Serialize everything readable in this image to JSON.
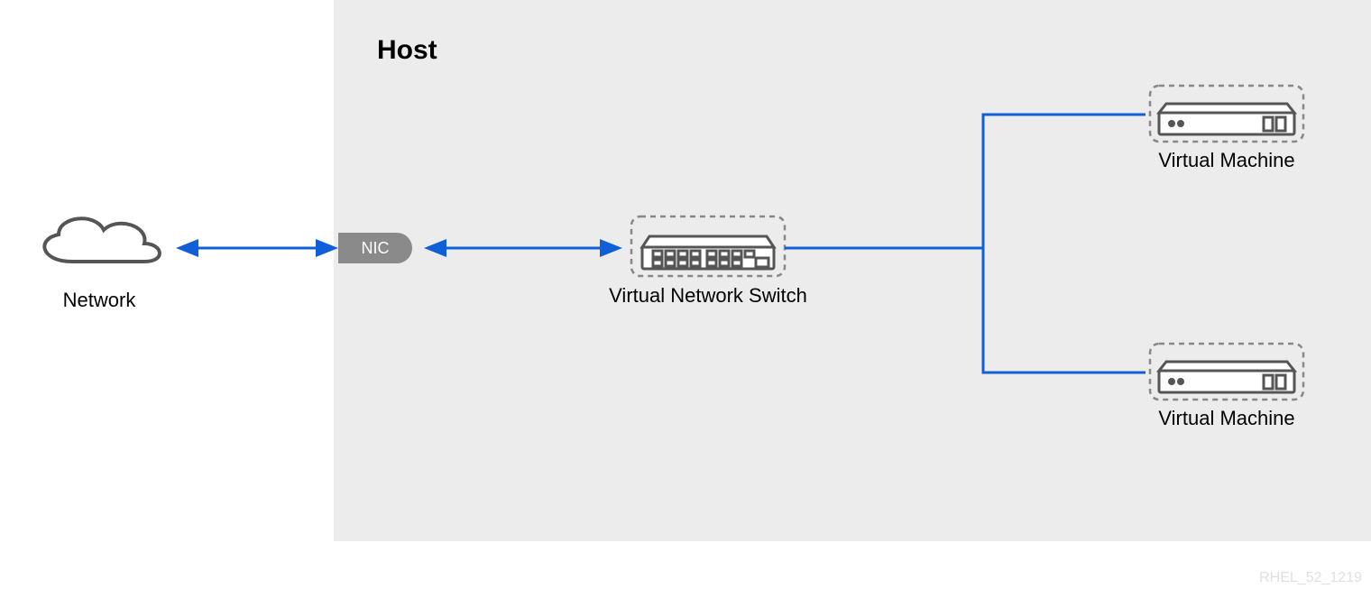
{
  "diagram": {
    "host_label": "Host",
    "network_label": "Network",
    "nic_label": "NIC",
    "switch_label": "Virtual Network Switch",
    "vm_label_1": "Virtual Machine",
    "vm_label_2": "Virtual Machine",
    "footer_id": "RHEL_52_1219"
  },
  "nodes": [
    {
      "id": "network",
      "type": "cloud",
      "label": "Network"
    },
    {
      "id": "nic",
      "type": "nic",
      "label": "NIC"
    },
    {
      "id": "switch",
      "type": "switch",
      "label": "Virtual Network Switch"
    },
    {
      "id": "vm1",
      "type": "vm",
      "label": "Virtual Machine"
    },
    {
      "id": "vm2",
      "type": "vm",
      "label": "Virtual Machine"
    }
  ],
  "edges": [
    {
      "from": "network",
      "to": "nic",
      "bidirectional": true
    },
    {
      "from": "nic",
      "to": "switch",
      "bidirectional": true
    },
    {
      "from": "switch",
      "to": "vm1",
      "bidirectional": false
    },
    {
      "from": "switch",
      "to": "vm2",
      "bidirectional": false
    }
  ],
  "region": {
    "host_contains": [
      "nic",
      "switch",
      "vm1",
      "vm2"
    ]
  }
}
